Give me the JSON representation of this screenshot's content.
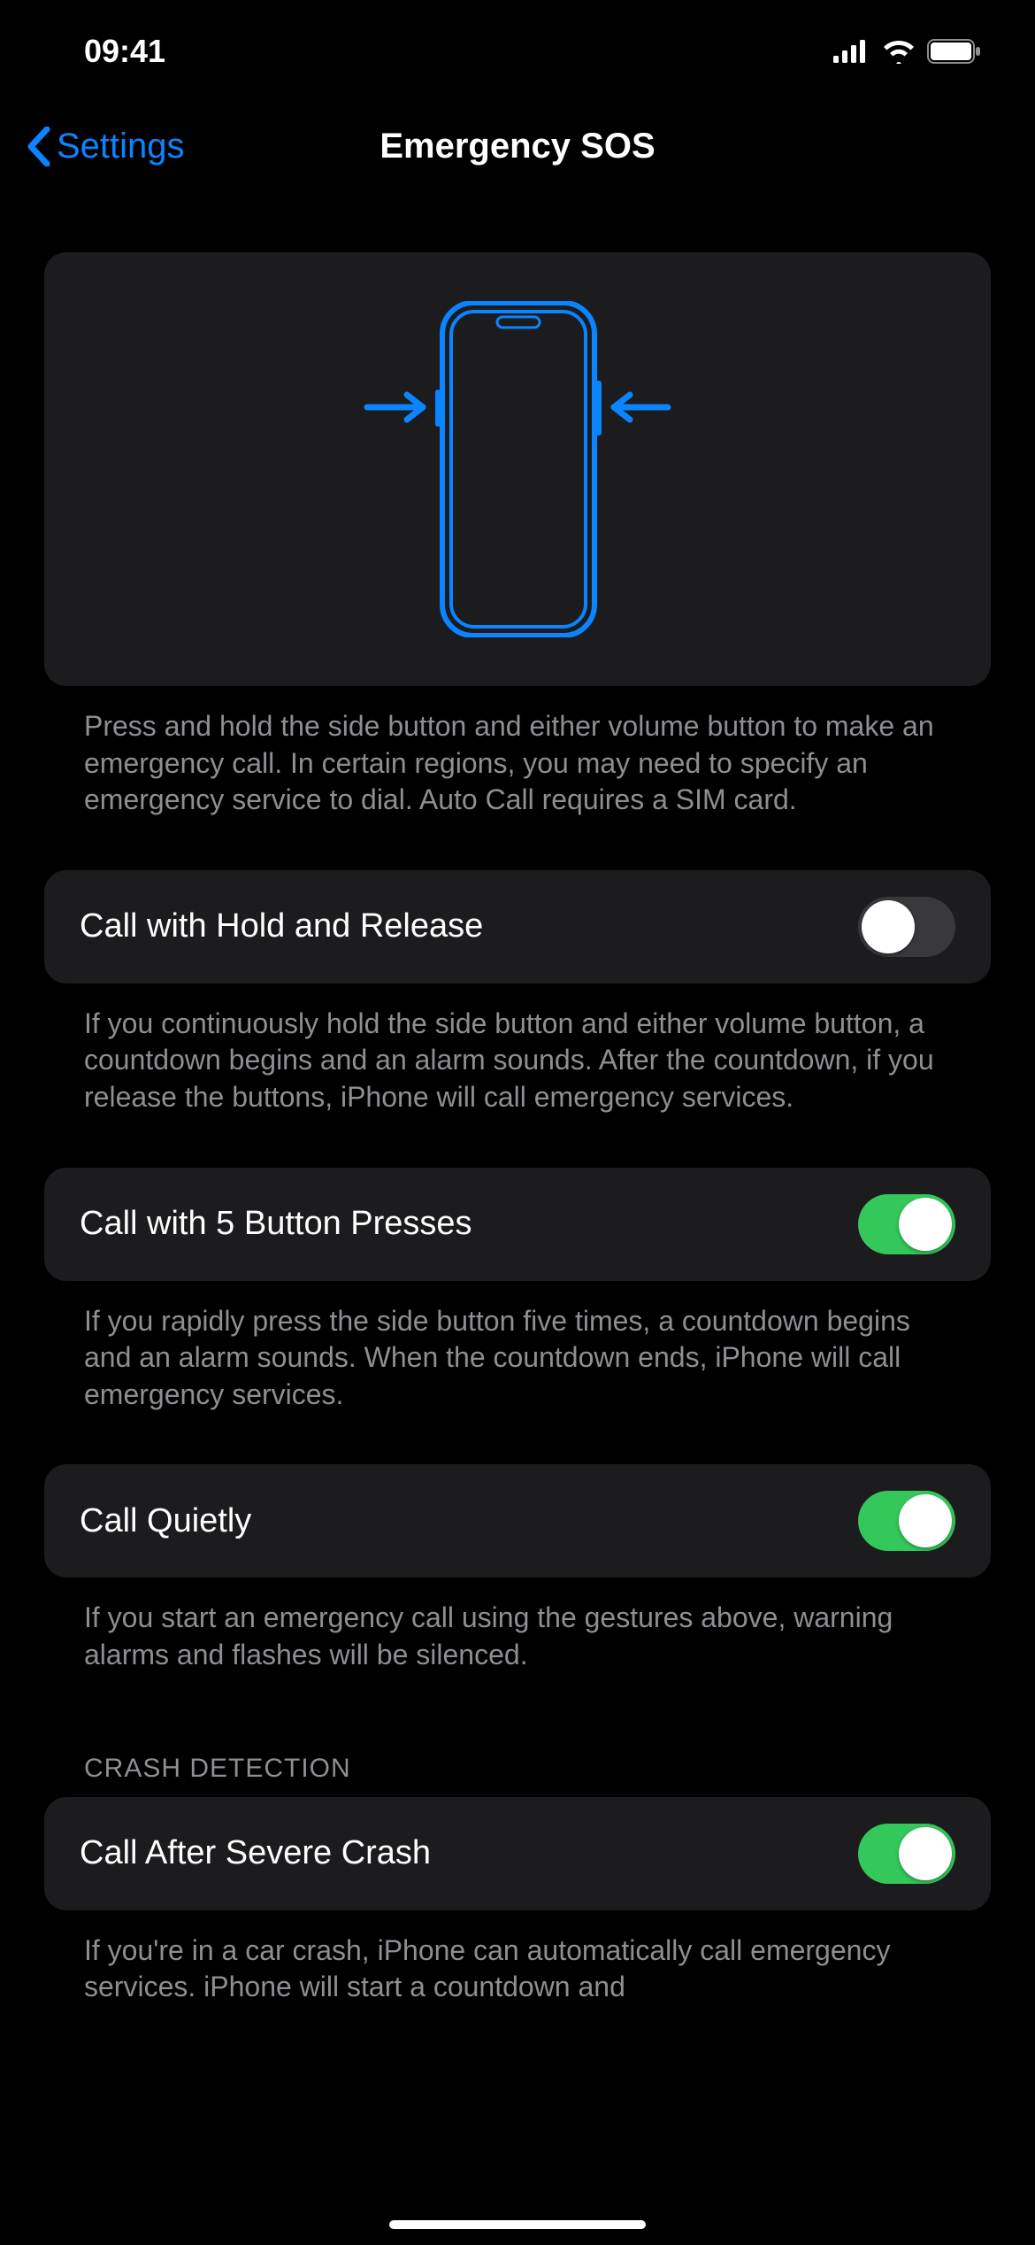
{
  "status": {
    "time": "09:41"
  },
  "nav": {
    "back": "Settings",
    "title": "Emergency SOS"
  },
  "diagram_footer": "Press and hold the side button and either volume button to make an emergency call. In certain regions, you may need to specify an emergency service to dial. Auto Call requires a SIM card.",
  "rows": [
    {
      "label": "Call with Hold and Release",
      "on": false,
      "footer": "If you continuously hold the side button and either volume button, a countdown begins and an alarm sounds. After the countdown, if you release the buttons, iPhone will call emergency services."
    },
    {
      "label": "Call with 5 Button Presses",
      "on": true,
      "footer": "If you rapidly press the side button five times, a countdown begins and an alarm sounds. When the countdown ends, iPhone will call emergency services."
    },
    {
      "label": "Call Quietly",
      "on": true,
      "footer": "If you start an emergency call using the gestures above, warning alarms and flashes will be silenced."
    }
  ],
  "section_header": "CRASH DETECTION",
  "crash_row": {
    "label": "Call After Severe Crash",
    "on": true,
    "footer": "If you're in a car crash, iPhone can automatically call emergency services. iPhone will start a countdown and"
  }
}
